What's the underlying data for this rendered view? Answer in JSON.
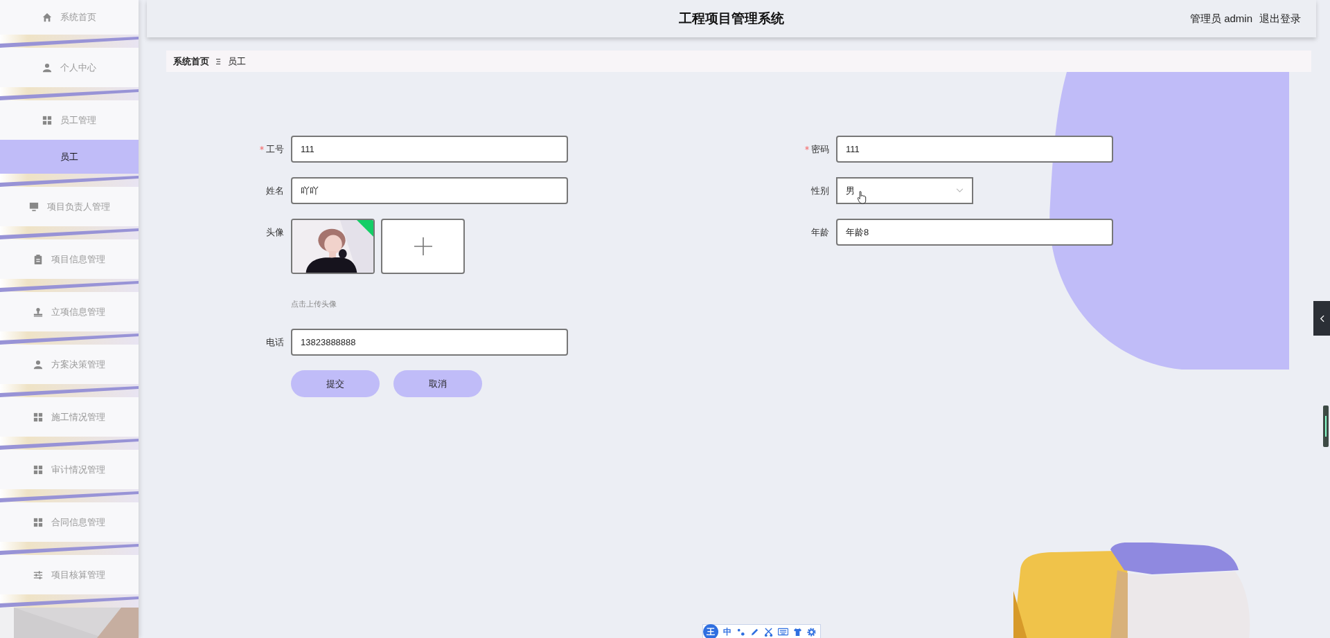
{
  "sidebar": {
    "items": [
      {
        "label": "系统首页",
        "selected": false,
        "kind": "menu"
      },
      {
        "label": "个人中心",
        "selected": false,
        "kind": "menu"
      },
      {
        "label": "员工管理",
        "selected": false,
        "kind": "menu"
      },
      {
        "label": "员工",
        "selected": true,
        "kind": "sub"
      },
      {
        "label": "项目负责人管理",
        "selected": false,
        "kind": "menu"
      },
      {
        "label": "项目信息管理",
        "selected": false,
        "kind": "menu"
      },
      {
        "label": "立项信息管理",
        "selected": false,
        "kind": "menu"
      },
      {
        "label": "方案决策管理",
        "selected": false,
        "kind": "menu"
      },
      {
        "label": "施工情况管理",
        "selected": false,
        "kind": "menu"
      },
      {
        "label": "审计情况管理",
        "selected": false,
        "kind": "menu"
      },
      {
        "label": "合同信息管理",
        "selected": false,
        "kind": "menu"
      },
      {
        "label": "项目核算管理",
        "selected": false,
        "kind": "menu"
      }
    ]
  },
  "header": {
    "title": "工程项目管理系统",
    "user": "管理员 admin",
    "logout": "退出登录"
  },
  "breadcrumb": [
    "系统首页",
    "员工"
  ],
  "form": {
    "left": [
      {
        "kind": "text",
        "label": "工号",
        "required": true,
        "value": "111"
      },
      {
        "kind": "text",
        "label": "姓名",
        "required": false,
        "value": "吖吖"
      },
      {
        "kind": "upload",
        "label": "头像",
        "required": false,
        "hint": "点击上传头像"
      },
      {
        "kind": "text",
        "label": "电话",
        "required": false,
        "value": "13823888888"
      }
    ],
    "right": [
      {
        "kind": "text",
        "label": "密码",
        "required": true,
        "value": "111"
      },
      {
        "kind": "select",
        "label": "性别",
        "required": false,
        "value": "男"
      },
      {
        "kind": "text",
        "label": "年龄",
        "required": false,
        "value": "年龄8"
      }
    ],
    "buttons": [
      {
        "label": "提交"
      },
      {
        "label": "取消"
      }
    ]
  },
  "ime_toolbar": {
    "logo": "王",
    "mode": "中"
  }
}
